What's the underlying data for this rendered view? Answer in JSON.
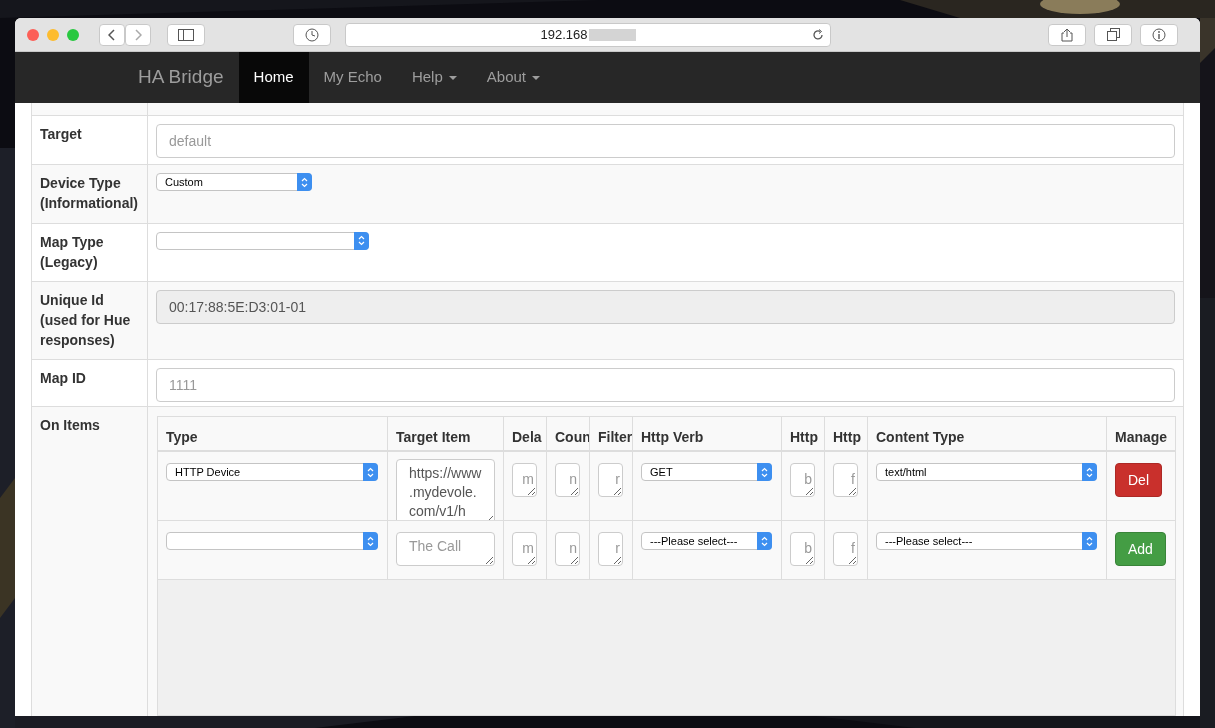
{
  "browser": {
    "address": "192.168"
  },
  "navbar": {
    "brand": "HA Bridge",
    "items": [
      {
        "label": "Home",
        "selected": true,
        "dropdown": false
      },
      {
        "label": "My Echo",
        "selected": false,
        "dropdown": false
      },
      {
        "label": "Help",
        "selected": false,
        "dropdown": true
      },
      {
        "label": "About",
        "selected": false,
        "dropdown": true
      }
    ]
  },
  "form": {
    "rows": [
      {
        "label": "Target",
        "kind": "input",
        "placeholder": "default"
      },
      {
        "label": "Device Type (Informational)",
        "kind": "select",
        "value": "Custom"
      },
      {
        "label": "Map Type (Legacy)",
        "kind": "select"
      },
      {
        "label": "Unique Id (used for Hue responses)",
        "kind": "input",
        "value": "00:17:88:5E:D3:01-01",
        "disabled": true
      },
      {
        "label": "Map ID",
        "kind": "input",
        "placeholder": "1111"
      }
    ]
  },
  "on_items": {
    "label": "On Items",
    "columns": [
      "Type",
      "Target Item",
      "Dela",
      "Coun",
      "Filter",
      "Http Verb",
      "Http",
      "Http",
      "Content Type",
      "Manage"
    ],
    "rows": [
      {
        "type": {
          "value": "HTTP Device"
        },
        "target": {
          "value": "https://www.mydevole.com/v1/h"
        },
        "delay": {
          "placeholder": "m"
        },
        "count": {
          "placeholder": "n"
        },
        "filter": {
          "placeholder": "r"
        },
        "verb": {
          "value": "GET"
        },
        "http_1": {
          "placeholder": "b"
        },
        "http_2": {
          "placeholder": "f"
        },
        "content_type": {
          "value": "text/html"
        },
        "action": {
          "kind": "delete",
          "label": "Del"
        }
      },
      {
        "type": {},
        "target": {
          "placeholder": "The Call"
        },
        "delay": {
          "placeholder": "m"
        },
        "count": {
          "placeholder": "n"
        },
        "filter": {
          "placeholder": "r"
        },
        "verb": {
          "value": "---Please select---"
        },
        "http_1": {
          "placeholder": "b"
        },
        "http_2": {
          "placeholder": "f"
        },
        "content_type": {
          "value": "---Please select---"
        },
        "action": {
          "kind": "add",
          "label": "Add"
        }
      }
    ]
  }
}
